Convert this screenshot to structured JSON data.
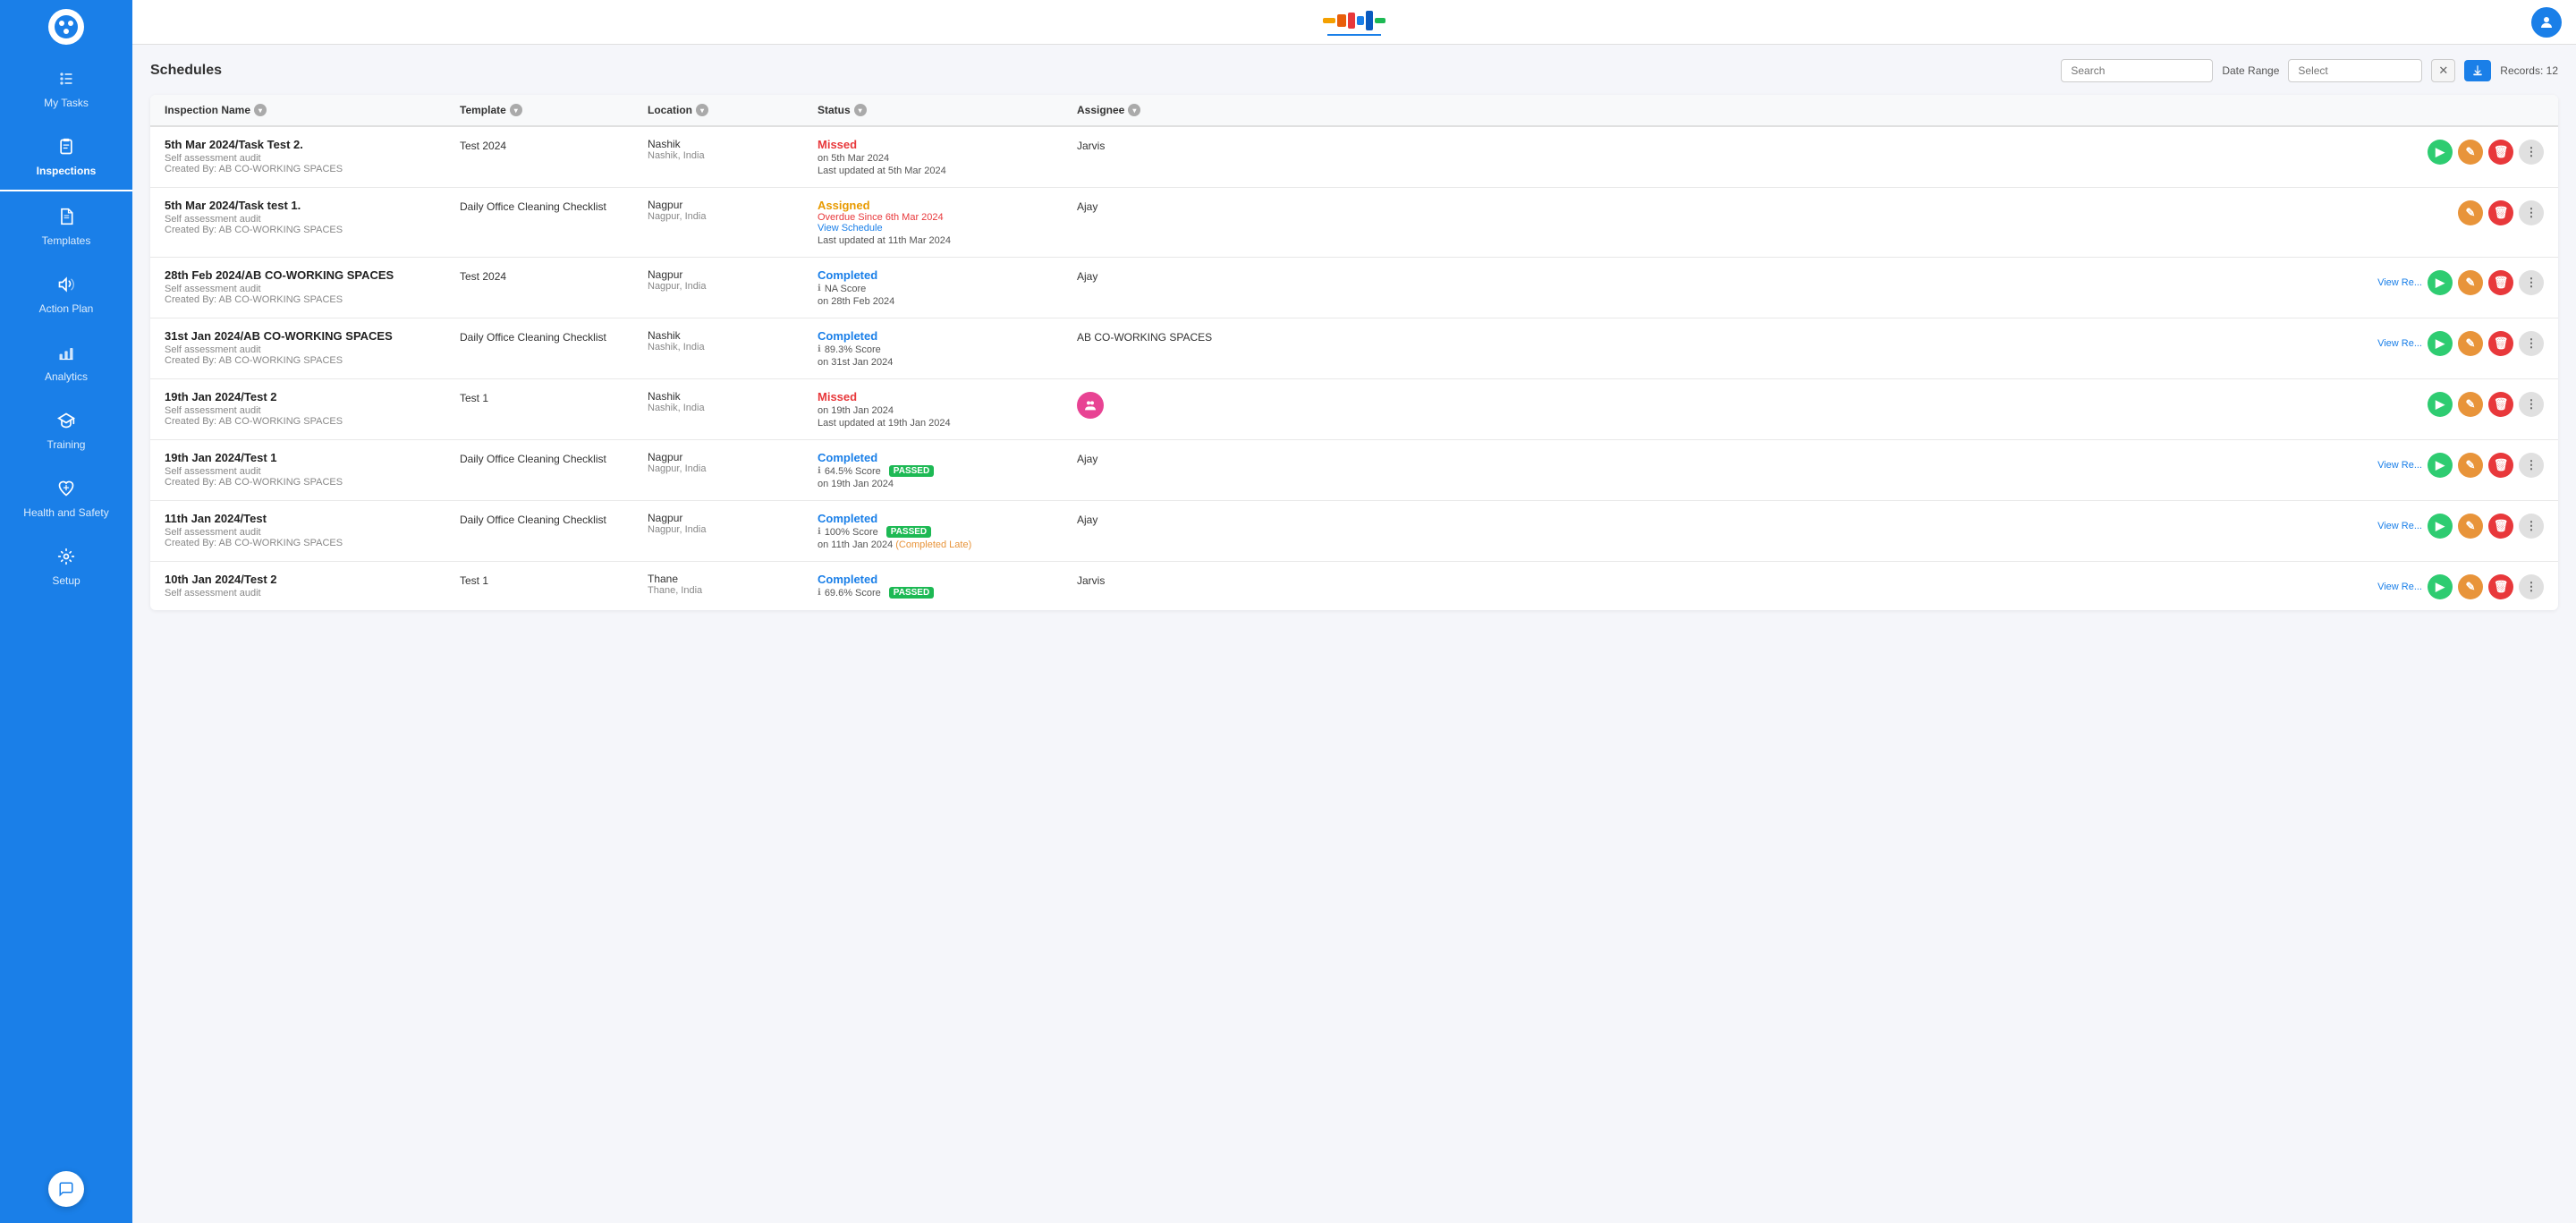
{
  "sidebar": {
    "logo_alt": "App Logo",
    "items": [
      {
        "id": "my-tasks",
        "label": "My Tasks",
        "icon": "tasks"
      },
      {
        "id": "inspections",
        "label": "Inspections",
        "icon": "clipboard",
        "active": true
      },
      {
        "id": "templates",
        "label": "Templates",
        "icon": "file"
      },
      {
        "id": "action-plan",
        "label": "Action Plan",
        "icon": "megaphone"
      },
      {
        "id": "analytics",
        "label": "Analytics",
        "icon": "chart"
      },
      {
        "id": "training",
        "label": "Training",
        "icon": "graduation"
      },
      {
        "id": "health-safety",
        "label": "Health and Safety",
        "icon": "heart"
      },
      {
        "id": "setup",
        "label": "Setup",
        "icon": "gear"
      }
    ]
  },
  "topbar": {
    "user_icon": "person"
  },
  "page": {
    "title": "Schedules",
    "records_label": "Records: 12",
    "search_placeholder": "Search",
    "date_range_label": "Date Range",
    "select_placeholder": "Select"
  },
  "table": {
    "columns": [
      {
        "label": "Inspection Name"
      },
      {
        "label": "Template"
      },
      {
        "label": "Location"
      },
      {
        "label": "Status"
      },
      {
        "label": "Assignee"
      }
    ],
    "rows": [
      {
        "id": 1,
        "name": "5th Mar 2024/Task Test 2.",
        "type": "Self assessment audit",
        "created_by": "Created By: AB CO-WORKING SPACES",
        "template": "Test 2024",
        "location": "Nashik",
        "location_sub": "Nashik, India",
        "status": "Missed",
        "status_type": "missed",
        "status_date": "on 5th Mar 2024",
        "status_updated": "Last updated at 5th Mar 2024",
        "assignee": "Jarvis",
        "assignee_color": "#e89a00",
        "show_view_re": false,
        "show_green_btn": true
      },
      {
        "id": 2,
        "name": "5th Mar 2024/Task test 1.",
        "type": "Self assessment audit",
        "created_by": "Created By: AB CO-WORKING SPACES",
        "template": "Daily Office Cleaning Checklist",
        "location": "Nagpur",
        "location_sub": "Nagpur, India",
        "status": "Assigned",
        "status_type": "assigned",
        "overdue": "Overdue Since 6th Mar 2024",
        "view_schedule": "View Schedule",
        "status_updated": "Last updated at 11th Mar 2024",
        "assignee": "Ajay",
        "assignee_color": "#e89a00",
        "show_view_re": false,
        "show_green_btn": false
      },
      {
        "id": 3,
        "name": "28th Feb 2024/AB CO-WORKING SPACES",
        "type": "Self assessment audit",
        "created_by": "Created By: AB CO-WORKING SPACES",
        "template": "Test 2024",
        "location": "Nagpur",
        "location_sub": "Nagpur, India",
        "status": "Completed",
        "status_type": "completed",
        "score": "NA Score",
        "status_date": "on 28th Feb 2024",
        "assignee": "Ajay",
        "assignee_color": "#e89a00",
        "show_view_re": true,
        "show_green_btn": true
      },
      {
        "id": 4,
        "name": "31st Jan 2024/AB CO-WORKING SPACES",
        "type": "Self assessment audit",
        "created_by": "Created By: AB CO-WORKING SPACES",
        "template": "Daily Office Cleaning Checklist",
        "location": "Nashik",
        "location_sub": "Nashik, India",
        "status": "Completed",
        "status_type": "completed",
        "score": "89.3% Score",
        "status_date": "on 31st Jan 2024",
        "assignee": "AB CO-WORKING SPACES",
        "assignee_color": "#1a7fe8",
        "show_view_re": true,
        "show_green_btn": true
      },
      {
        "id": 5,
        "name": "19th Jan 2024/Test 2",
        "type": "Self assessment audit",
        "created_by": "Created By: AB CO-WORKING SPACES",
        "template": "Test 1",
        "location": "Nashik",
        "location_sub": "Nashik, India",
        "status": "Missed",
        "status_type": "missed",
        "status_date": "on 19th Jan 2024",
        "status_updated": "Last updated at 19th Jan 2024",
        "assignee_avatar": "multi",
        "assignee": "",
        "show_view_re": false,
        "show_green_btn": true
      },
      {
        "id": 6,
        "name": "19th Jan 2024/Test 1",
        "type": "Self assessment audit",
        "created_by": "Created By: AB CO-WORKING SPACES",
        "template": "Daily Office Cleaning Checklist",
        "location": "Nagpur",
        "location_sub": "Nagpur, India",
        "status": "Completed",
        "status_type": "completed",
        "score": "64.5% Score",
        "passed": true,
        "status_date": "on 19th Jan 2024",
        "assignee": "Ajay",
        "assignee_color": "#e89a00",
        "show_view_re": true,
        "show_green_btn": true
      },
      {
        "id": 7,
        "name": "11th Jan 2024/Test",
        "type": "Self assessment audit",
        "created_by": "Created By: AB CO-WORKING SPACES",
        "template": "Daily Office Cleaning Checklist",
        "location": "Nagpur",
        "location_sub": "Nagpur, India",
        "status": "Completed",
        "status_type": "completed",
        "score": "100% Score",
        "passed": true,
        "status_date": "on 11th Jan 2024",
        "completed_late": "(Completed Late)",
        "assignee": "Ajay",
        "assignee_color": "#e89a00",
        "show_view_re": true,
        "show_green_btn": true
      },
      {
        "id": 8,
        "name": "10th Jan 2024/Test 2",
        "type": "Self assessment audit",
        "created_by": "",
        "template": "Test 1",
        "location": "Thane",
        "location_sub": "Thane, India",
        "status": "Completed",
        "status_type": "completed",
        "score": "69.6% Score",
        "passed": true,
        "status_date": "",
        "assignee": "Jarvis",
        "assignee_color": "#e89a00",
        "show_view_re": true,
        "show_green_btn": true
      }
    ]
  }
}
